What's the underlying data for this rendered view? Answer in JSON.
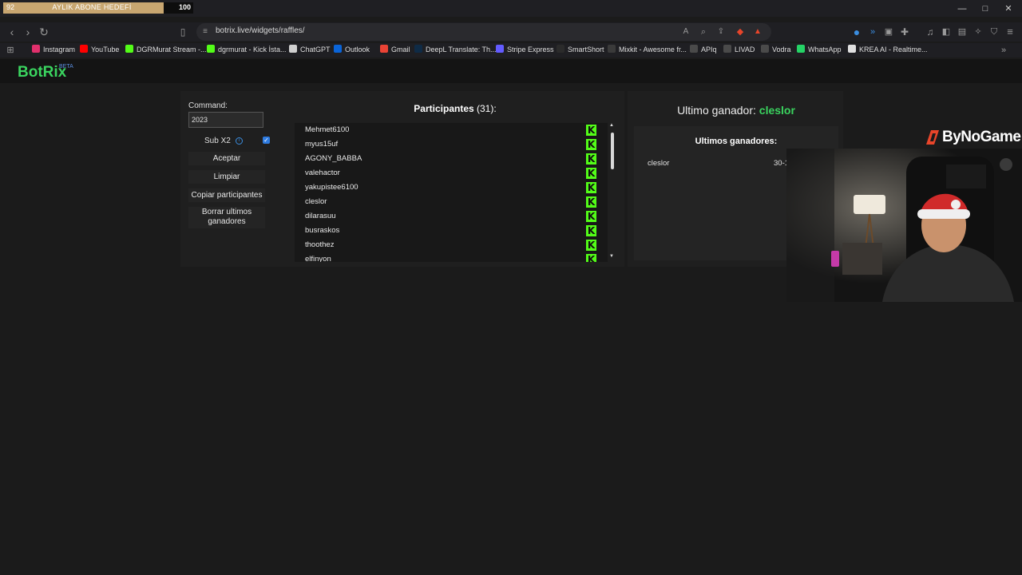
{
  "sub_goal": {
    "current": "92",
    "label": "AYLIK ABONE HEDEFİ",
    "target": "100",
    "progress": 0.92,
    "bar_color": "#c8a670"
  },
  "window_controls": {
    "minimize": "—",
    "maximize": "□",
    "close": "✕"
  },
  "nav": {
    "url": "botrix.live/widgets/raffles/"
  },
  "bookmarks": [
    {
      "label": "Instagram",
      "color": "#e1306c"
    },
    {
      "label": "YouTube",
      "color": "#ff0000"
    },
    {
      "label": "DGRMurat Stream -...",
      "color": "#53fc18"
    },
    {
      "label": "dgrmurat - Kick İsta...",
      "color": "#53fc18"
    },
    {
      "label": "ChatGPT",
      "color": "#cfcfcf"
    },
    {
      "label": "Outlook",
      "color": "#0a64d8"
    },
    {
      "label": "Gmail",
      "color": "#ea4335"
    },
    {
      "label": "DeepL Translate: Th...",
      "color": "#0f2b46"
    },
    {
      "label": "Stripe Express",
      "color": "#635bff"
    },
    {
      "label": "SmartShort",
      "color": "#2b2b2b"
    },
    {
      "label": "Mixkit - Awesome fr...",
      "color": "#3a3a3a"
    },
    {
      "label": "APIq",
      "color": "#4a4a4a"
    },
    {
      "label": "LIVAD",
      "color": "#4a4a4a"
    },
    {
      "label": "Vodra",
      "color": "#4a4a4a"
    },
    {
      "label": "WhatsApp",
      "color": "#25d366"
    },
    {
      "label": "KREA AI - Realtime...",
      "color": "#e0e0e0"
    }
  ],
  "app": {
    "logo": "BotRix",
    "logo_badge": "BETA",
    "logo_color": "#3ad45f"
  },
  "raffle": {
    "command_label": "Command:",
    "command_value": "2023",
    "sub_x2_label": "Sub X2",
    "sub_x2_checked": true,
    "buttons": {
      "accept": "Aceptar",
      "clear": "Limpiar",
      "copy": "Copiar participantes",
      "delete_winners": "Borrar ultimos ganadores"
    },
    "participants_title": "Participantes",
    "participants_count": "(31):",
    "participants": [
      "Mehmet6100",
      "myus15uf",
      "AGONY_BABBA",
      "valehactor",
      "yakupistee6100",
      "cleslor",
      "dilarasuu",
      "busraskos",
      "thoothez",
      "elfinyon"
    ],
    "kick_badge": "K",
    "kick_color": "#53fc18"
  },
  "winners": {
    "last_winner_label": "Ultimo ganador:",
    "last_winner_name": "cleslor",
    "title": "Ultimos ganadores:",
    "rows": [
      {
        "name": "cleslor",
        "date": "30-1"
      }
    ]
  },
  "brand_overlay": {
    "text": "ByNoGame",
    "color": "#e8452a"
  }
}
